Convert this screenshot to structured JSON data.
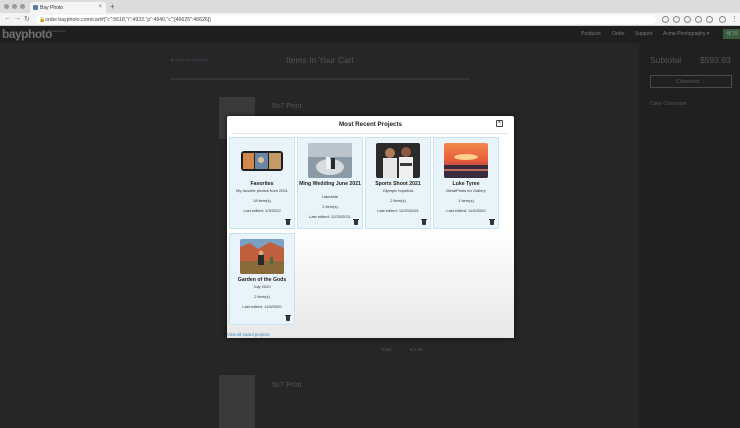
{
  "browser": {
    "tab_title": "Bay Photo",
    "tab_close": "×",
    "new_tab": "+",
    "url": "order.bayphoto.com/cart#{\"c\":5618,\"i\":4932,\"p\":4940,\"c\":[46625\":46626]}",
    "back": "←",
    "forward": "→",
    "reload": "↻"
  },
  "site": {
    "logo": "bayphoto",
    "logo_sub": "Personal Photo Lab",
    "nav": [
      "Products",
      "Order",
      "Support",
      "Acme Photography ▾"
    ],
    "cart_count": "15"
  },
  "background": {
    "continue_link": "◀ Continue Shopping",
    "cart_title": "Items In Your Cart",
    "item_title_1": "5x7 Print",
    "item_title_2": "5x7 Print",
    "total_label": "Total:",
    "total_value": "$ 1.99",
    "subtotal_label": "Subtotal",
    "subtotal_value": "$593.93",
    "checkout_label": "Checkout →",
    "color_correction": "Color Correction"
  },
  "modal": {
    "title": "Most Recent Projects",
    "close": "×",
    "view_all": "View all saved projects",
    "projects": [
      {
        "name": "Favorites",
        "desc": "My favorite photos from 2021",
        "count": "18 item(s)",
        "edited": "Last edited: 1/3/2022"
      },
      {
        "name": "Ming Wedding June 2021",
        "desc": "Lakeside",
        "count": "2 item(s)",
        "edited": "Last edited: 12/20/2021"
      },
      {
        "name": "Sports Shoot 2021",
        "desc": "Olympic hopefuls",
        "count": "2 item(s)",
        "edited": "Last edited: 12/20/2021"
      },
      {
        "name": "Luke Tyree",
        "desc": "MetalPrints for Gallery",
        "count": "1 item(s)",
        "edited": "Last edited: 11/5/2020"
      },
      {
        "name": "Garden of the Gods",
        "desc": "July 2020",
        "count": "2 item(s)",
        "edited": "Last edited: 11/5/2020"
      }
    ]
  },
  "colors": {
    "card_bg": "#e9f4fa",
    "card_border": "#c7e3f1",
    "link": "#3a8ac4"
  }
}
